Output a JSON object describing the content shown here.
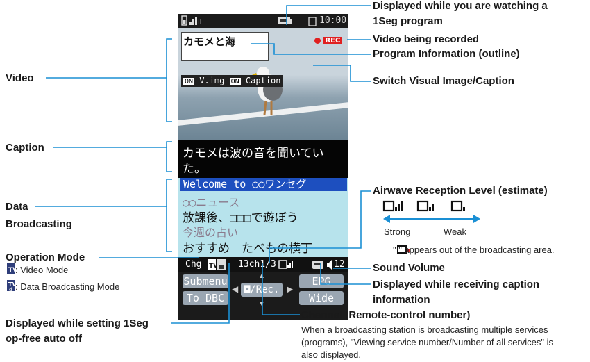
{
  "phone": {
    "clock": "10:00",
    "program_name": "カモメと海",
    "rec_badge": "REC",
    "toggles": [
      {
        "state": "ON",
        "label": "V.img"
      },
      {
        "state": "ON",
        "label": "Caption"
      }
    ],
    "caption_text": [
      "カモメは波の音を聞いてい",
      "た。"
    ],
    "data_broadcast": {
      "header": "Welcome to ○○ワンセグ",
      "lines": [
        "○○ニュース",
        "放課後、□□□で遊ぼう",
        "今週の占い",
        "おすすめ　たべもの横丁"
      ]
    },
    "status_row": {
      "ch_label": "Chg",
      "channel": "13ch1/3",
      "volume": "12"
    },
    "softkeys": {
      "submenu": "Submenu",
      "to_dbc": "To DBC",
      "rec": "Rec.",
      "epg": "EPG",
      "wide": "Wide"
    }
  },
  "labels": {
    "video": "Video",
    "caption": "Caption",
    "data_broadcasting_1": "Data",
    "data_broadcasting_2": "Broadcasting",
    "operation_mode": "Operation Mode",
    "video_mode": ": Video Mode",
    "data_mode": ": Data Broadcasting Mode",
    "op_free_1": "Displayed while setting 1Seg",
    "op_free_2": "op-free auto off",
    "watching_1": "Displayed while you are watching a",
    "watching_2": "1Seg program",
    "recorded": "Video being recorded",
    "program_info": "Program Information (outline)",
    "switch": "Switch Visual Image/Caption",
    "airwave": "Airwave Reception Level (estimate)",
    "strong": "Strong",
    "weak": "Weak",
    "out_of_area": "\" \" appears out of the broadcasting area.",
    "sound_volume": "Sound Volume",
    "receiving_caption_1": "Displayed while receiving caption",
    "receiving_caption_2": "information",
    "channel": "Channel (Remote-control number)",
    "channel_note_1": "When a broadcasting station is broadcasting multiple services",
    "channel_note_2": "(programs), \"Viewing service number/Number of all services\" is",
    "channel_note_3": "also displayed."
  },
  "colors": {
    "line": "#1a8fd4",
    "rec_red": "#e02020",
    "softkey": "#9aa6b2",
    "data_bg": "#b7e3ec",
    "header_blue": "#1d4fbf",
    "sky": "#c9d4dc"
  }
}
